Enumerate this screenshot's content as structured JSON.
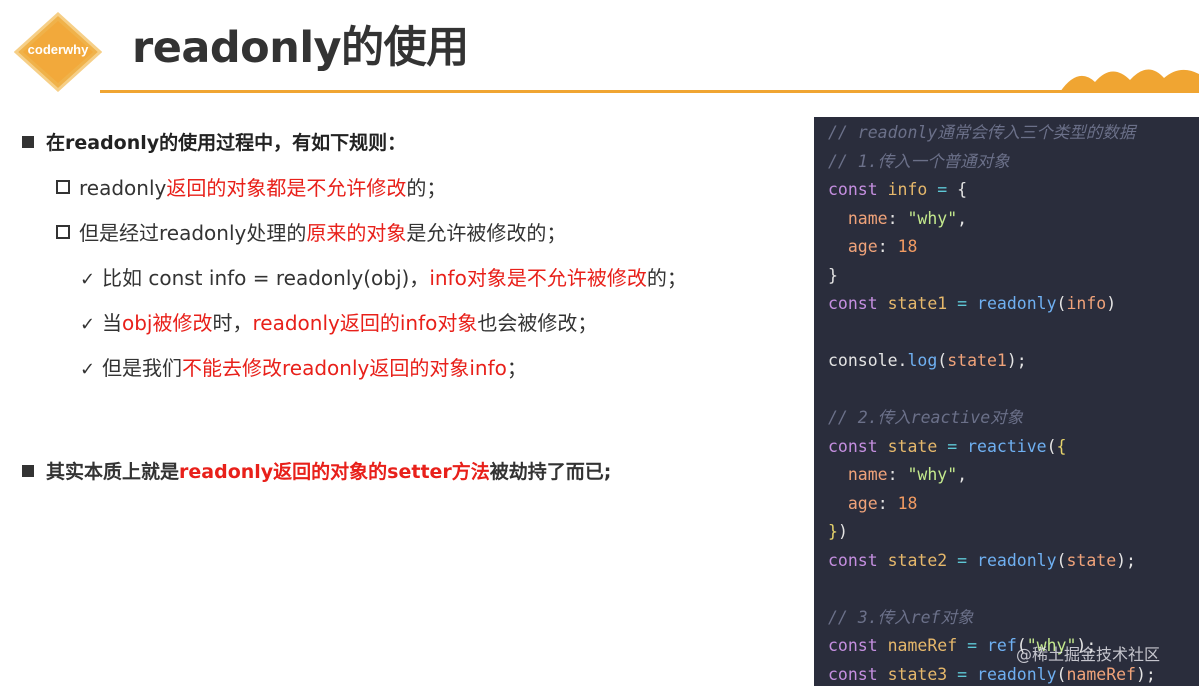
{
  "header": {
    "logo_text": "coderwhy",
    "title": "readonly的使用"
  },
  "bullets": {
    "b1": "在readonly的使用过程中，有如下规则：",
    "b1_1": [
      {
        "text": "readonly",
        "red": false
      },
      {
        "text": "返回的对象都是不允许修改",
        "red": true
      },
      {
        "text": "的；",
        "red": false
      }
    ],
    "b1_2": [
      {
        "text": "但是经过readonly处理的",
        "red": false
      },
      {
        "text": "原来的对象",
        "red": true
      },
      {
        "text": "是允许被修改的；",
        "red": false
      }
    ],
    "b1_2_1": [
      {
        "text": "比如 const info = readonly(obj)，",
        "red": false
      },
      {
        "text": "info对象是不允许被修改",
        "red": true
      },
      {
        "text": "的；",
        "red": false
      }
    ],
    "b1_2_2": [
      {
        "text": "当",
        "red": false
      },
      {
        "text": "obj被修改",
        "red": true
      },
      {
        "text": "时，",
        "red": false
      },
      {
        "text": "readonly返回的info对象",
        "red": true
      },
      {
        "text": "也会被修改；",
        "red": false
      }
    ],
    "b1_2_3": [
      {
        "text": "但是我们",
        "red": false
      },
      {
        "text": "不能去修改readonly返回的对象info",
        "red": true
      },
      {
        "text": "；",
        "red": false
      }
    ],
    "b2": [
      {
        "text": "其实本质上就是",
        "red": false
      },
      {
        "text": "readonly返回的对象的setter方法",
        "red": true
      },
      {
        "text": "被劫持了而已;",
        "red": false
      }
    ]
  },
  "code_lines": [
    [
      {
        "t": "// readonly通常会传入三个类型的数据",
        "c": "cm"
      }
    ],
    [
      {
        "t": "// 1.传入一个普通对象",
        "c": "cm"
      }
    ],
    [
      {
        "t": "const",
        "c": "kw"
      },
      {
        "t": " ",
        "c": "pn"
      },
      {
        "t": "info",
        "c": "var"
      },
      {
        "t": " = ",
        "c": "op"
      },
      {
        "t": "{",
        "c": "pn"
      }
    ],
    [
      {
        "t": "  ",
        "c": "pn"
      },
      {
        "t": "name",
        "c": "prop"
      },
      {
        "t": ": ",
        "c": "pn"
      },
      {
        "t": "\"why\"",
        "c": "str"
      },
      {
        "t": ",",
        "c": "pn"
      }
    ],
    [
      {
        "t": "  ",
        "c": "pn"
      },
      {
        "t": "age",
        "c": "prop"
      },
      {
        "t": ": ",
        "c": "pn"
      },
      {
        "t": "18",
        "c": "num"
      }
    ],
    [
      {
        "t": "}",
        "c": "pn"
      }
    ],
    [
      {
        "t": "const",
        "c": "kw"
      },
      {
        "t": " ",
        "c": "pn"
      },
      {
        "t": "state1",
        "c": "var"
      },
      {
        "t": " = ",
        "c": "op"
      },
      {
        "t": "readonly",
        "c": "fn"
      },
      {
        "t": "(",
        "c": "pn"
      },
      {
        "t": "info",
        "c": "prop"
      },
      {
        "t": ")",
        "c": "pn"
      }
    ],
    [
      {
        "t": "",
        "c": "pn"
      }
    ],
    [
      {
        "t": "console",
        "c": "pn"
      },
      {
        "t": ".",
        "c": "pn"
      },
      {
        "t": "log",
        "c": "fn"
      },
      {
        "t": "(",
        "c": "pn"
      },
      {
        "t": "state1",
        "c": "prop"
      },
      {
        "t": ");",
        "c": "pn"
      }
    ],
    [
      {
        "t": "",
        "c": "pn"
      }
    ],
    [
      {
        "t": "// 2.传入reactive对象",
        "c": "cm"
      }
    ],
    [
      {
        "t": "const",
        "c": "kw"
      },
      {
        "t": " ",
        "c": "pn"
      },
      {
        "t": "state",
        "c": "var"
      },
      {
        "t": " = ",
        "c": "op"
      },
      {
        "t": "reactive",
        "c": "fn"
      },
      {
        "t": "(",
        "c": "pn"
      },
      {
        "t": "{",
        "c": "br"
      }
    ],
    [
      {
        "t": "  ",
        "c": "pn"
      },
      {
        "t": "name",
        "c": "prop"
      },
      {
        "t": ": ",
        "c": "pn"
      },
      {
        "t": "\"why\"",
        "c": "str"
      },
      {
        "t": ",",
        "c": "pn"
      }
    ],
    [
      {
        "t": "  ",
        "c": "pn"
      },
      {
        "t": "age",
        "c": "prop"
      },
      {
        "t": ": ",
        "c": "pn"
      },
      {
        "t": "18",
        "c": "num"
      }
    ],
    [
      {
        "t": "}",
        "c": "br"
      },
      {
        "t": ")",
        "c": "pn"
      }
    ],
    [
      {
        "t": "const",
        "c": "kw"
      },
      {
        "t": " ",
        "c": "pn"
      },
      {
        "t": "state2",
        "c": "var"
      },
      {
        "t": " = ",
        "c": "op"
      },
      {
        "t": "readonly",
        "c": "fn"
      },
      {
        "t": "(",
        "c": "pn"
      },
      {
        "t": "state",
        "c": "prop"
      },
      {
        "t": ");",
        "c": "pn"
      }
    ],
    [
      {
        "t": "",
        "c": "pn"
      }
    ],
    [
      {
        "t": "// 3.传入ref对象",
        "c": "cm"
      }
    ],
    [
      {
        "t": "const",
        "c": "kw"
      },
      {
        "t": " ",
        "c": "pn"
      },
      {
        "t": "nameRef",
        "c": "var"
      },
      {
        "t": " = ",
        "c": "op"
      },
      {
        "t": "ref",
        "c": "fn"
      },
      {
        "t": "(",
        "c": "pn"
      },
      {
        "t": "\"why\"",
        "c": "str"
      },
      {
        "t": ");",
        "c": "pn"
      }
    ],
    [
      {
        "t": "const",
        "c": "kw"
      },
      {
        "t": " ",
        "c": "pn"
      },
      {
        "t": "state3",
        "c": "var"
      },
      {
        "t": " = ",
        "c": "op"
      },
      {
        "t": "readonly",
        "c": "fn"
      },
      {
        "t": "(",
        "c": "pn"
      },
      {
        "t": "nameRef",
        "c": "prop"
      },
      {
        "t": ");",
        "c": "pn"
      }
    ]
  ],
  "watermark": "@稀土掘金技术社区",
  "colors": {
    "accent": "#f0a532",
    "highlight_red": "#e8201a",
    "code_bg": "#2a2d3c"
  }
}
